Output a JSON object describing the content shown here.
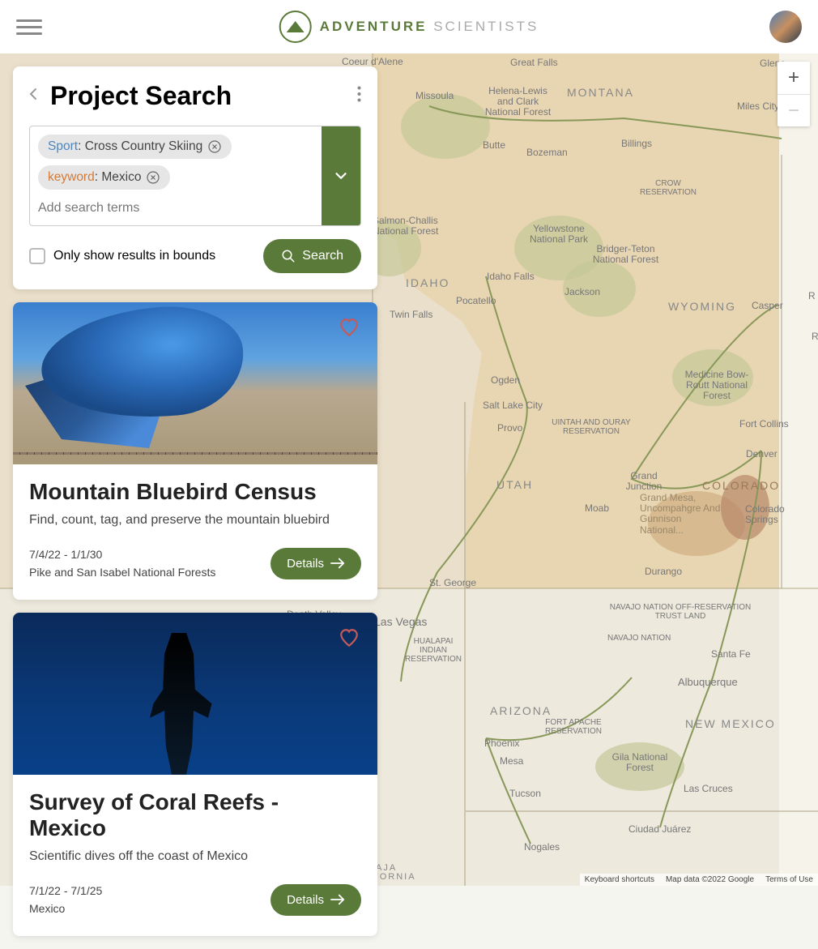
{
  "brand": {
    "name_bold": "ADVENTURE",
    "name_light": "SCIENTISTS"
  },
  "search": {
    "title": "Project Search",
    "placeholder": "Add search terms",
    "bounds_label": "Only show results in bounds",
    "search_btn": "Search",
    "tags": [
      {
        "key": "Sport",
        "key_color": "tag-key-sport",
        "value": "Cross Country Skiing"
      },
      {
        "key": "keyword",
        "key_color": "tag-key-keyword",
        "value": "Mexico"
      }
    ]
  },
  "results": [
    {
      "title": "Mountain Bluebird Census",
      "desc": "Find, count, tag, and preserve the mountain bluebird",
      "date_range": "7/4/22 - 1/1/30",
      "location": "Pike and San Isabel National Forests",
      "details_label": "Details"
    },
    {
      "title": "Survey of Coral Reefs - Mexico",
      "desc": "Scientific dives off the coast of Mexico",
      "date_range": "7/1/22 - 7/1/25",
      "location": "Mexico",
      "details_label": "Details"
    }
  ],
  "map": {
    "zoom_in": "+",
    "zoom_out": "−",
    "footer": {
      "shortcuts": "Keyboard shortcuts",
      "attribution": "Map data ©2022 Google",
      "terms": "Terms of Use"
    },
    "labels": {
      "coeur": "Coeur d'Alene",
      "greatfalls": "Great Falls",
      "missoula": "Missoula",
      "helena": "Helena-Lewis and Clark National Forest",
      "montana": "MONTANA",
      "milescity": "Miles City",
      "butte": "Butte",
      "bozeman": "Bozeman",
      "billings": "Billings",
      "glen": "Glenc",
      "crow": "CROW RESERVATION",
      "salmon": "Salmon-Challis National Forest",
      "yellowstone": "Yellowstone National Park",
      "bridger": "Bridger-Teton National Forest",
      "idaho": "IDAHO",
      "idahofalls": "Idaho Falls",
      "jackson": "Jackson",
      "pocatello": "Pocatello",
      "twinfalls": "Twin Falls",
      "wyoming": "WYOMING",
      "casper": "Casper",
      "medicine": "Medicine Bow-Routt National Forest",
      "ogden": "Ogden",
      "saltlake": "Salt Lake City",
      "provo": "Provo",
      "uintah": "UINTAH AND OURAY RESERVATION",
      "ftcollins": "Fort Collins",
      "denver": "Denver",
      "utah": "UTAH",
      "grandjct": "Grand Junction",
      "colorado": "COLORADO",
      "cosprings": "Colorado Springs",
      "grandmesa": "Grand Mesa, Uncompahgre And Gunnison National...",
      "moab": "Moab",
      "stgeorge": "St. George",
      "vegas": "Las Vegas",
      "durango": "Durango",
      "navajo1": "NAVAJO NATION OFF-RESERVATION TRUST LAND",
      "navajo2": "NAVAJO NATION",
      "hualapai": "HUALAPAI INDIAN RESERVATION",
      "santafe": "Santa Fe",
      "albuquerque": "Albuquerque",
      "arizona": "ARIZONA",
      "ftapache": "FORT APACHE RESERVATION",
      "newmexico": "NEW MEXICO",
      "phoenix": "Phoenix",
      "mesa": "Mesa",
      "gila": "Gila National Forest",
      "tucson": "Tucson",
      "lascruces": "Las Cruces",
      "juarez": "Ciudad Juárez",
      "nogales": "Nogales",
      "california": "CALIFORNIA",
      "deathvalley": "Death Valley",
      "fornia": "FORNIA",
      "aja": "AJA",
      "r1": "R",
      "r2": "Ri"
    }
  }
}
